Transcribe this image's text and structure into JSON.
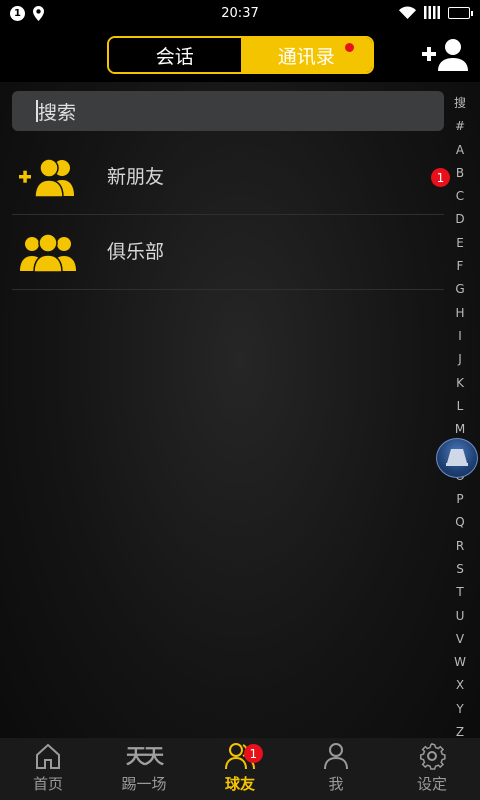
{
  "status_bar": {
    "notification_count": "1",
    "time": "20:37"
  },
  "header": {
    "tabs": [
      {
        "label": "会话",
        "active": false
      },
      {
        "label": "通讯录",
        "active": true,
        "has_dot": true
      }
    ],
    "add_contact_icon": "add-user-icon"
  },
  "search": {
    "placeholder": "搜索"
  },
  "list": [
    {
      "label": "新朋友",
      "icon": "add-friends-icon",
      "badge": "1"
    },
    {
      "label": "俱乐部",
      "icon": "group-icon"
    }
  ],
  "index_bar": [
    "搜",
    "#",
    "A",
    "B",
    "C",
    "D",
    "E",
    "F",
    "G",
    "H",
    "I",
    "J",
    "K",
    "L",
    "M",
    "N",
    "O",
    "P",
    "Q",
    "R",
    "S",
    "T",
    "U",
    "V",
    "W",
    "X",
    "Y",
    "Z"
  ],
  "bottom_nav": [
    {
      "label": "首页",
      "icon": "home-icon"
    },
    {
      "label": "踢一场",
      "icon": "tiantian-logo",
      "logo_text": "天天"
    },
    {
      "label": "球友",
      "icon": "friends-icon",
      "active": true,
      "badge": "1"
    },
    {
      "label": "我",
      "icon": "person-icon"
    },
    {
      "label": "设定",
      "icon": "gear-icon"
    }
  ],
  "colors": {
    "accent": "#f5c400",
    "badge": "#e8101a",
    "background": "#141414"
  }
}
